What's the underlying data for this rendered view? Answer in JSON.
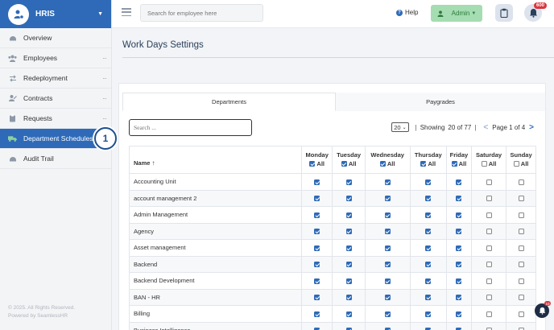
{
  "brand": {
    "title": "HRIS"
  },
  "sidebar": {
    "items": [
      {
        "label": "Overview",
        "icon": "dashboard-icon",
        "more": false,
        "active": false
      },
      {
        "label": "Employees",
        "icon": "users-icon",
        "more": true,
        "active": false
      },
      {
        "label": "Redeployment",
        "icon": "swap-icon",
        "more": true,
        "active": false
      },
      {
        "label": "Contracts",
        "icon": "contract-icon",
        "more": true,
        "active": false
      },
      {
        "label": "Requests",
        "icon": "clipboard-icon",
        "more": true,
        "active": false
      },
      {
        "label": "Department Schedules",
        "icon": "truck-icon",
        "more": false,
        "active": true
      },
      {
        "label": "Audit Trail",
        "icon": "dashboard-icon",
        "more": false,
        "active": false
      }
    ],
    "marker": "1",
    "footer_line1": "© 2025. All Rights Reserved.",
    "footer_line2": "Powered by SeamlessHR"
  },
  "topbar": {
    "search_placeholder": "Search for employee here",
    "help_label": "Help",
    "admin_label": "Admin",
    "notif_count": "600"
  },
  "main": {
    "title": "Work Days Settings",
    "tabs": [
      {
        "label": "Departments",
        "active": true
      },
      {
        "label": "Paygrades",
        "active": false
      }
    ],
    "search_placeholder": "Search ...",
    "page_size": "20",
    "showing_label": "Showing",
    "showing_range": "20 of 77",
    "page_label": "Page 1 of 4"
  },
  "table": {
    "name_header": "Name",
    "days": [
      {
        "label": "Monday",
        "all": true
      },
      {
        "label": "Tuesday",
        "all": true
      },
      {
        "label": "Wednesday",
        "all": true
      },
      {
        "label": "Thursday",
        "all": true
      },
      {
        "label": "Friday",
        "all": true
      },
      {
        "label": "Saturday",
        "all": false
      },
      {
        "label": "Sunday",
        "all": false
      }
    ],
    "all_label": "All",
    "rows": [
      {
        "name": "Accounting Unit",
        "checks": [
          true,
          true,
          true,
          true,
          true,
          false,
          false
        ]
      },
      {
        "name": "account management 2",
        "checks": [
          true,
          true,
          true,
          true,
          true,
          false,
          false
        ]
      },
      {
        "name": "Admin Management",
        "checks": [
          true,
          true,
          true,
          true,
          true,
          false,
          false
        ]
      },
      {
        "name": "Agency",
        "checks": [
          true,
          true,
          true,
          true,
          true,
          false,
          false
        ]
      },
      {
        "name": "Asset management",
        "checks": [
          true,
          true,
          true,
          true,
          true,
          false,
          false
        ]
      },
      {
        "name": "Backend",
        "checks": [
          true,
          true,
          true,
          true,
          true,
          false,
          false
        ]
      },
      {
        "name": "Backend Development",
        "checks": [
          true,
          true,
          true,
          true,
          true,
          false,
          false
        ]
      },
      {
        "name": "BAN - HR",
        "checks": [
          true,
          true,
          true,
          true,
          true,
          false,
          false
        ]
      },
      {
        "name": "Billing",
        "checks": [
          true,
          true,
          true,
          true,
          true,
          false,
          false
        ]
      },
      {
        "name": "Business Intelligence",
        "checks": [
          true,
          true,
          true,
          true,
          true,
          false,
          false
        ]
      }
    ]
  },
  "float_notif_count": "10",
  "colors": {
    "primary": "#2e6ab7",
    "admin_bg": "#a5dcb1",
    "badge": "#d9363e"
  }
}
